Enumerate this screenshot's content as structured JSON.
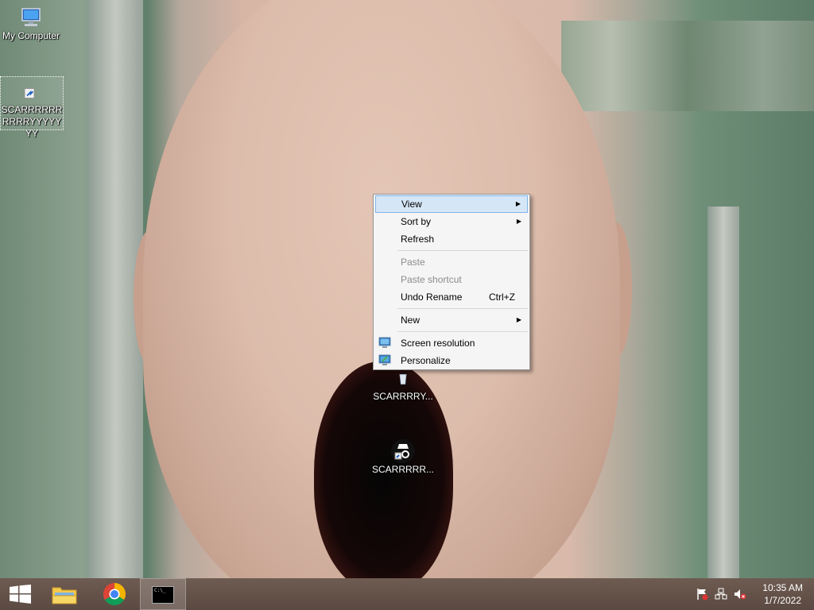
{
  "desktop": {
    "icons": [
      {
        "label": "My Computer",
        "icon": "computer-icon"
      },
      {
        "label": "SCARRRRRRRRRRYYYYYYY",
        "icon": "shortcut-icon",
        "selected": true
      },
      {
        "label": "SCARRRRY...",
        "icon": "recycle-bin-icon"
      },
      {
        "label": "SCARRRRR...",
        "icon": "spy-shortcut-icon"
      }
    ]
  },
  "context_menu": {
    "items": [
      {
        "label": "View",
        "submenu": true,
        "highlighted": true
      },
      {
        "label": "Sort by",
        "submenu": true
      },
      {
        "label": "Refresh"
      },
      {
        "label": "Paste",
        "disabled": true
      },
      {
        "label": "Paste shortcut",
        "disabled": true
      },
      {
        "label": "Undo Rename",
        "shortcut": "Ctrl+Z"
      },
      {
        "label": "New",
        "submenu": true
      },
      {
        "label": "Screen resolution",
        "icon": "monitor-icon"
      },
      {
        "label": "Personalize",
        "icon": "personalize-icon"
      }
    ],
    "submenu_arrow": "▶"
  },
  "taskbar": {
    "buttons": [
      {
        "name": "start",
        "icon": "windows-logo-icon"
      },
      {
        "name": "file-explorer",
        "icon": "folder-icon"
      },
      {
        "name": "chrome",
        "icon": "chrome-icon"
      },
      {
        "name": "command-prompt",
        "icon": "cmd-icon",
        "active": true,
        "glyph_text": "C:\\_"
      }
    ],
    "tray": [
      "action-center-flag-icon",
      "network-icon",
      "volume-muted-icon"
    ],
    "time": "10:35 AM",
    "date": "1/7/2022"
  },
  "colors": {
    "menu_highlight": "#d5e6f7",
    "menu_highlight_border": "#7eb4ea",
    "taskbar": "#5f4e45"
  }
}
